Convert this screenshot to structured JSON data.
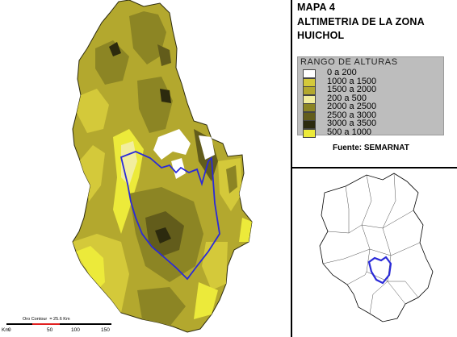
{
  "title": {
    "line1": "MAPA 4",
    "line2": "ALTIMETRIA DE LA ZONA",
    "line3": "HUICHOL"
  },
  "legend": {
    "title": "RANGO DE ALTURAS",
    "items": [
      {
        "label": "0 a 200",
        "color": "#ffffff"
      },
      {
        "label": "1000 a 1500",
        "color": "#d4c93a"
      },
      {
        "label": "1500 a 2000",
        "color": "#b3a82e"
      },
      {
        "label": "200 a 500",
        "color": "#f2ee9e"
      },
      {
        "label": "2000 a 2500",
        "color": "#8c8524"
      },
      {
        "label": "2500 a 3000",
        "color": "#625c1b"
      },
      {
        "label": "3000 a 3500",
        "color": "#2c2a0e"
      },
      {
        "label": "500 a 1000",
        "color": "#ecea3a"
      }
    ]
  },
  "source": "Fuente: SEMARNAT",
  "scale": {
    "title": "Oro Contour  = 25.6 Km",
    "unit": "Km",
    "ticks": [
      "0",
      "50",
      "100",
      "150"
    ]
  },
  "colors": {
    "zone_outline": "#2a2ad8",
    "land_light": "#ecea3a",
    "land_dark": "#2c2a0e"
  }
}
